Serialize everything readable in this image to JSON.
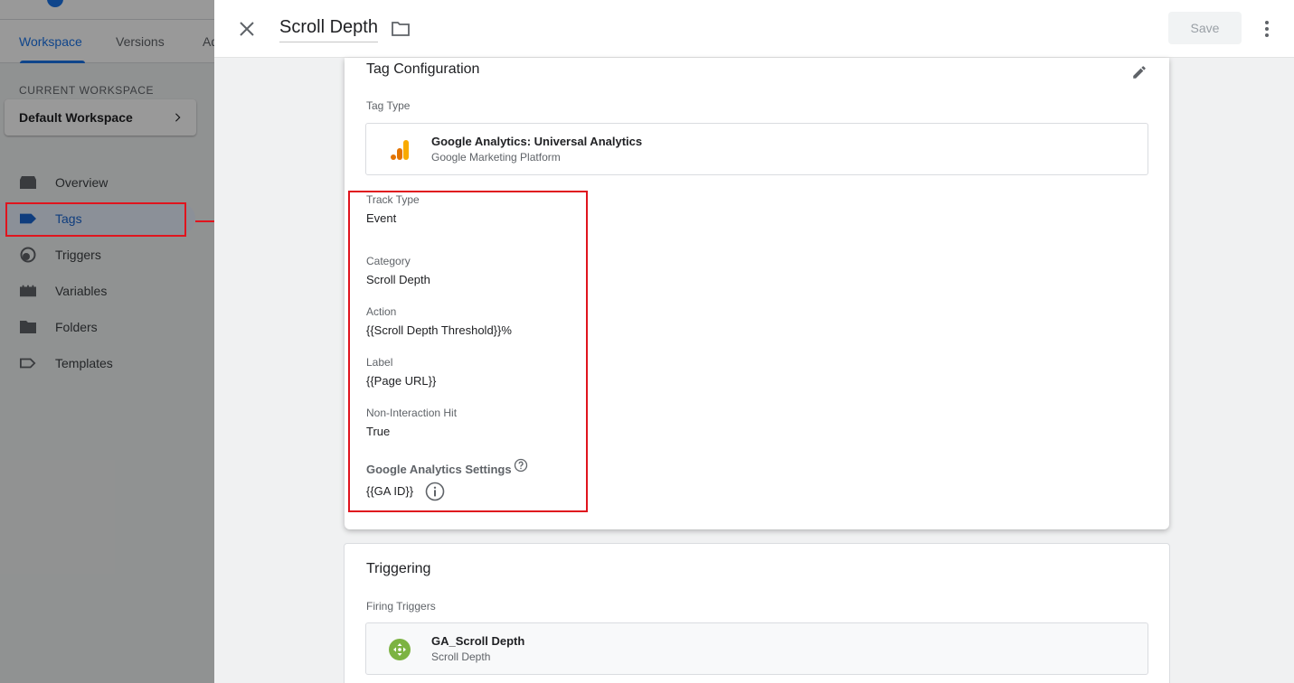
{
  "background": {
    "tabs": [
      "Workspace",
      "Versions",
      "Ad"
    ],
    "current_workspace_label": "CURRENT WORKSPACE",
    "workspace_name": "Default Workspace",
    "nav": [
      {
        "label": "Overview",
        "icon": "overview-icon"
      },
      {
        "label": "Tags",
        "icon": "tag-icon",
        "active": true
      },
      {
        "label": "Triggers",
        "icon": "trigger-icon"
      },
      {
        "label": "Variables",
        "icon": "variables-icon"
      },
      {
        "label": "Folders",
        "icon": "folder-icon"
      },
      {
        "label": "Templates",
        "icon": "template-icon"
      }
    ]
  },
  "panel": {
    "title": "Scroll Depth",
    "save_label": "Save"
  },
  "tag_configuration": {
    "title": "Tag Configuration",
    "tag_type_label": "Tag Type",
    "tag_type": {
      "name": "Google Analytics: Universal Analytics",
      "provider": "Google Marketing Platform",
      "icon": "google-analytics-icon"
    },
    "fields": {
      "track_type": {
        "label": "Track Type",
        "value": "Event"
      },
      "category": {
        "label": "Category",
        "value": "Scroll Depth"
      },
      "action": {
        "label": "Action",
        "value": "{{Scroll Depth Threshold}}%"
      },
      "label": {
        "label": "Label",
        "value": "{{Page URL}}"
      },
      "non_interaction": {
        "label": "Non-Interaction Hit",
        "value": "True"
      }
    },
    "ga_settings": {
      "label": "Google Analytics Settings",
      "value": "{{GA ID}}"
    }
  },
  "triggering": {
    "title": "Triggering",
    "firing_label": "Firing Triggers",
    "trigger": {
      "name": "GA_Scroll Depth",
      "type": "Scroll Depth",
      "icon": "scroll-depth-trigger-icon"
    }
  },
  "colors": {
    "accent": "#1a73e8",
    "annotation": "#e0141e",
    "ga_orange": "#f9ab00",
    "ga_dark_orange": "#e37400",
    "trigger_green": "#7cb342"
  }
}
